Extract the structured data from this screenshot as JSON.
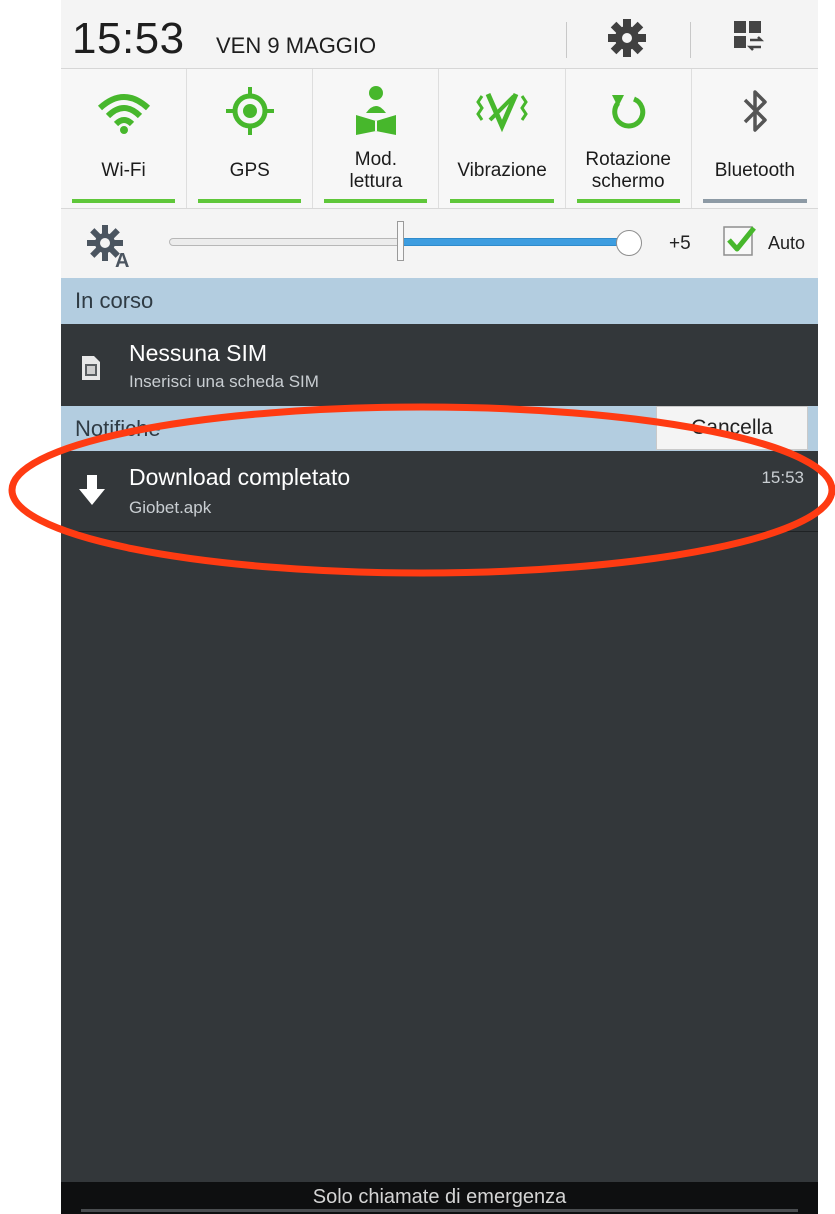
{
  "status": {
    "time": "15:53",
    "date": "VEN 9 MAGGIO",
    "settings_icon": "gear-icon",
    "multiwindow_icon": "multi-window-icon"
  },
  "toggles": [
    {
      "label": "Wi-Fi",
      "icon": "wifi-icon",
      "active": true
    },
    {
      "label": "GPS",
      "icon": "gps-icon",
      "active": true
    },
    {
      "label": "Mod.\nlettura",
      "icon": "reading-mode-icon",
      "active": true
    },
    {
      "label": "Vibrazione",
      "icon": "vibration-icon",
      "active": true
    },
    {
      "label": "Rotazione\nschermo",
      "icon": "rotation-icon",
      "active": true
    },
    {
      "label": "Bluetooth",
      "icon": "bluetooth-icon",
      "active": false
    }
  ],
  "brightness": {
    "level": 0.55,
    "value": "+5",
    "auto_label": "Auto",
    "auto_checked": true
  },
  "ongoing": {
    "header": "In corso",
    "items": [
      {
        "title": "Nessuna SIM",
        "subtitle": "Inserisci una scheda SIM",
        "icon": "sim-card-icon"
      }
    ]
  },
  "notifications": {
    "header": "Notifiche",
    "clear_label": "Cancella",
    "items": [
      {
        "title": "Download completato",
        "subtitle": "Giobet.apk",
        "time": "15:53",
        "icon": "download-arrow-icon"
      }
    ]
  },
  "footer": {
    "text": "Solo chiamate di emergenza"
  },
  "colors": {
    "accent_green": "#5fc73a",
    "panel_dark": "#33373a",
    "section_blue": "#b3cde0",
    "annotation_red": "#ff3b12"
  }
}
